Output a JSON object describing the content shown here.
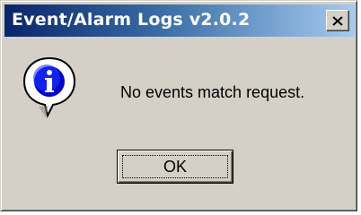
{
  "window": {
    "title": "Event/Alarm Logs v2.0.2",
    "close_icon": "close-x-icon"
  },
  "dialog": {
    "icon": "information-icon",
    "message": "No events match request.",
    "ok_label": "OK"
  }
}
